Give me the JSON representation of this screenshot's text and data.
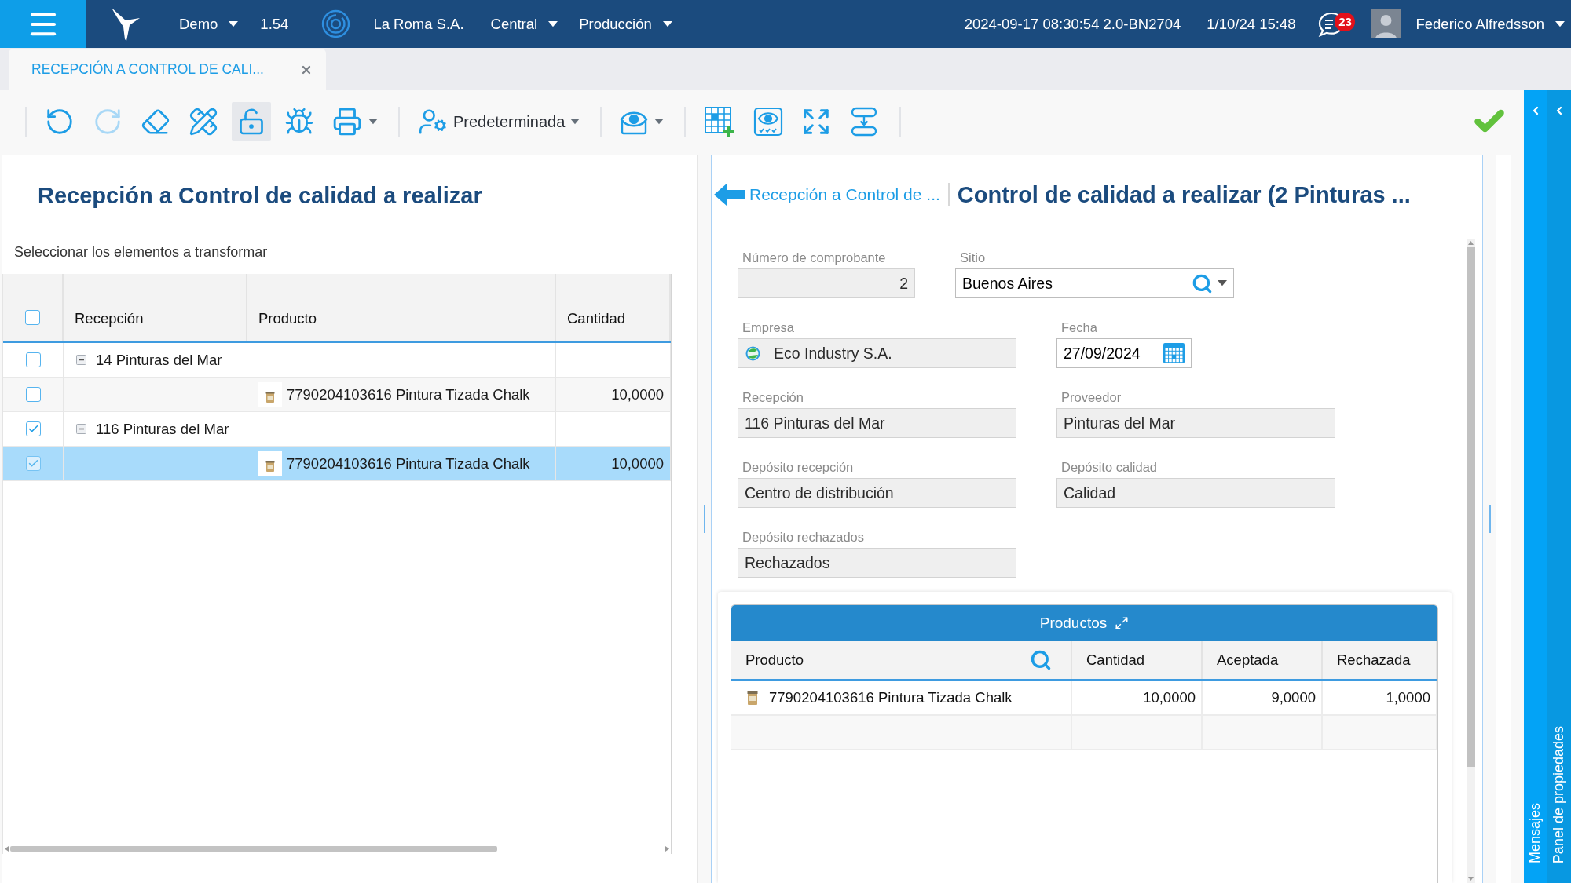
{
  "top_bar": {
    "environment": "Demo",
    "version": "1.54",
    "company": "La Roma S.A.",
    "branch": "Central",
    "module": "Producción",
    "build": "2024-09-17 08:30:54 2.0-BN2704",
    "datetime": "1/10/24 15:48",
    "unread_messages": "23",
    "user": "Federico Alfredsson"
  },
  "tabs": [
    {
      "label": "RECEPCIÓN A CONTROL DE CALI...",
      "selected": true
    }
  ],
  "toolbar": {
    "items": [
      {
        "kind": "separator"
      },
      {
        "kind": "button",
        "disabled": false,
        "pressed": false,
        "dropdown": false
      },
      {
        "kind": "button",
        "disabled": true,
        "pressed": false,
        "dropdown": false
      },
      {
        "kind": "button",
        "disabled": false,
        "pressed": false,
        "dropdown": false
      },
      {
        "kind": "button",
        "disabled": false,
        "pressed": false,
        "dropdown": false
      },
      {
        "kind": "button",
        "disabled": false,
        "pressed": true,
        "dropdown": false
      },
      {
        "kind": "button",
        "disabled": false,
        "pressed": false,
        "dropdown": false
      },
      {
        "kind": "button",
        "disabled": false,
        "pressed": false,
        "dropdown": true
      },
      {
        "kind": "separator"
      },
      {
        "kind": "menu",
        "label": "Predeterminada"
      },
      {
        "kind": "separator"
      },
      {
        "kind": "button",
        "disabled": false,
        "pressed": false,
        "dropdown": true
      },
      {
        "kind": "separator"
      },
      {
        "kind": "button",
        "disabled": false,
        "pressed": false,
        "dropdown": false
      },
      {
        "kind": "button",
        "disabled": false,
        "pressed": false,
        "dropdown": false
      },
      {
        "kind": "button",
        "disabled": false,
        "pressed": false,
        "dropdown": false
      },
      {
        "kind": "button",
        "disabled": false,
        "pressed": false,
        "dropdown": false
      },
      {
        "kind": "separator"
      }
    ]
  },
  "left_panel": {
    "title": "Recepción a Control de calidad a realizar",
    "instruction": "Seleccionar los elementos a transformar",
    "table": {
      "all_checked": false,
      "columns": [
        "Recepción",
        "Producto",
        "Cantidad"
      ],
      "rows": [
        {
          "recepcion": "14 Pinturas del Mar",
          "checked": false,
          "selected": false,
          "expanded": true,
          "children": [
            {
              "producto": "7790204103616 Pintura Tizada Chalk",
              "cantidad": "10,0000",
              "checked": false,
              "selected": false
            }
          ]
        },
        {
          "recepcion": "116 Pinturas del Mar",
          "checked": true,
          "selected": false,
          "expanded": true,
          "children": [
            {
              "producto": "7790204103616 Pintura Tizada Chalk",
              "cantidad": "10,0000",
              "checked": true,
              "selected": true
            }
          ]
        }
      ]
    }
  },
  "right_panel": {
    "breadcrumb": "Recepción a Control de ...",
    "title": "Control de calidad a realizar (2 Pinturas ...",
    "form_rows": [
      [
        {
          "kind": "number",
          "label": "Número de comprobante",
          "value": "2",
          "readonly": true
        },
        {
          "kind": "lookup",
          "label": "Sitio",
          "value": "Buenos Aires",
          "readonly": false
        }
      ],
      [
        {
          "kind": "company",
          "label": "Empresa",
          "value": "Eco Industry S.A.",
          "readonly": true
        },
        {
          "kind": "date",
          "label": "Fecha",
          "value": "27/09/2024",
          "readonly": false
        }
      ],
      [
        {
          "kind": "text",
          "label": "Recepción",
          "value": "116 Pinturas del Mar",
          "readonly": true
        },
        {
          "kind": "text",
          "label": "Proveedor",
          "value": "Pinturas del Mar",
          "readonly": true
        }
      ],
      [
        {
          "kind": "text",
          "label": "Depósito recepción",
          "value": "Centro de distribución",
          "readonly": true
        },
        {
          "kind": "text",
          "label": "Depósito calidad",
          "value": "Calidad",
          "readonly": true
        }
      ],
      [
        {
          "kind": "text",
          "label": "Depósito rechazados",
          "value": "Rechazados",
          "readonly": true
        }
      ]
    ],
    "products": {
      "title": "Productos",
      "columns": [
        "Producto",
        "Cantidad",
        "Aceptada",
        "Rechazada"
      ],
      "rows": [
        {
          "producto": "7790204103616 Pintura Tizada Chalk",
          "cantidad": "10,0000",
          "aceptada": "9,0000",
          "rechazada": "1,0000"
        }
      ]
    }
  },
  "side_panels": [
    {
      "label": "Mensajes"
    },
    {
      "label": "Panel de propiedades"
    }
  ]
}
